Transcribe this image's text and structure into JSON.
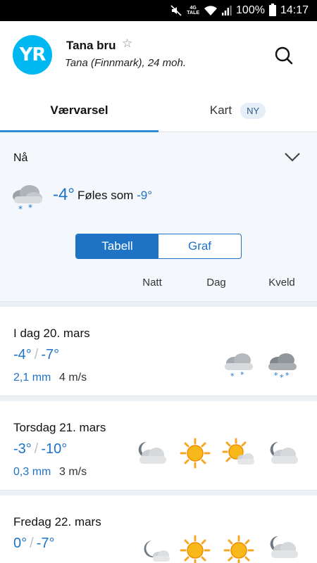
{
  "status_bar": {
    "network": "4G",
    "network_sub": "TALE",
    "battery": "100%",
    "time": "14:17"
  },
  "header": {
    "logo": "YR",
    "location_name": "Tana bru",
    "location_sub": "Tana (Finnmark), 24 moh.",
    "star_icon": "star-outline-icon",
    "search_icon": "search-icon"
  },
  "tabs": [
    {
      "label": "Værvarsel",
      "active": true
    },
    {
      "label": "Kart",
      "badge": "NY",
      "active": false
    }
  ],
  "now": {
    "label": "Nå",
    "icon": "cloud-snow-icon",
    "temp": "-4°",
    "feels_label": "Føles som",
    "feels_value": "-9°"
  },
  "view_toggle": {
    "options": [
      "Tabell",
      "Graf"
    ],
    "selected": "Tabell"
  },
  "columns": [
    "Natt",
    "Dag",
    "Kveld"
  ],
  "days": [
    {
      "title": "I dag 20. mars",
      "high": "-4°",
      "low": "-7°",
      "precip": "2,1 mm",
      "wind": "4 m/s",
      "icons": [
        "",
        "",
        "cloud-snow-icon",
        "cloud-heavy-snow-icon"
      ]
    },
    {
      "title": "Torsdag 21. mars",
      "high": "-3°",
      "low": "-10°",
      "precip": "0,3 mm",
      "wind": "3 m/s",
      "icons": [
        "moon-cloud-icon",
        "sun-icon",
        "sun-cloud-icon",
        "moon-cloud-icon"
      ]
    },
    {
      "title": "Fredag 22. mars",
      "high": "0°",
      "low": "-7°",
      "precip": "",
      "wind": "",
      "icons": [
        "moon-cloud-small-icon",
        "sun-icon",
        "sun-icon",
        "moon-cloud-icon"
      ]
    }
  ],
  "colors": {
    "accent": "#1f73c4",
    "logo": "#00b8f1",
    "tab_indicator": "#2f8ad8",
    "now_bg": "#f4f8fc"
  }
}
